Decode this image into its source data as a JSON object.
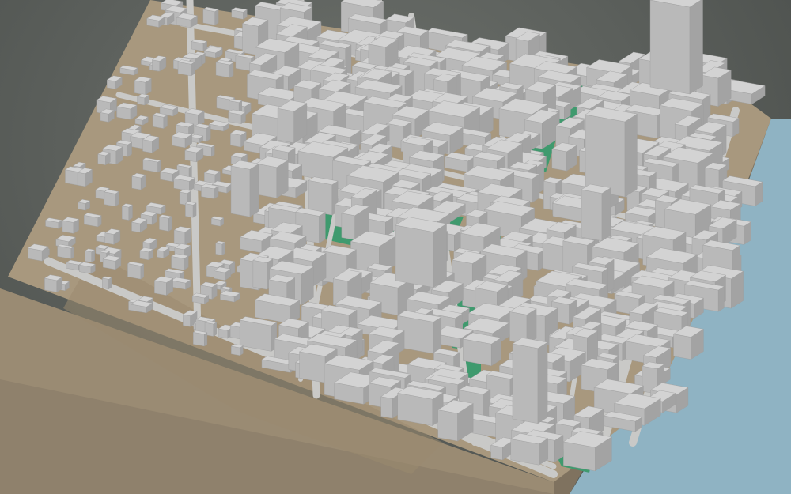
{
  "scene": {
    "description_free": true,
    "colors": {
      "background": "#5f635f",
      "terrain": "#a8987e",
      "terrain_dark": "#8c7d66",
      "base_side": "#8f816c",
      "road": "#c9c9c7",
      "building_top": "#d3d3d3",
      "building_left": "#b9b9b9",
      "building_right": "#a3a3a3",
      "park": "#3f9a6e",
      "water": "#8fb3c3"
    }
  }
}
